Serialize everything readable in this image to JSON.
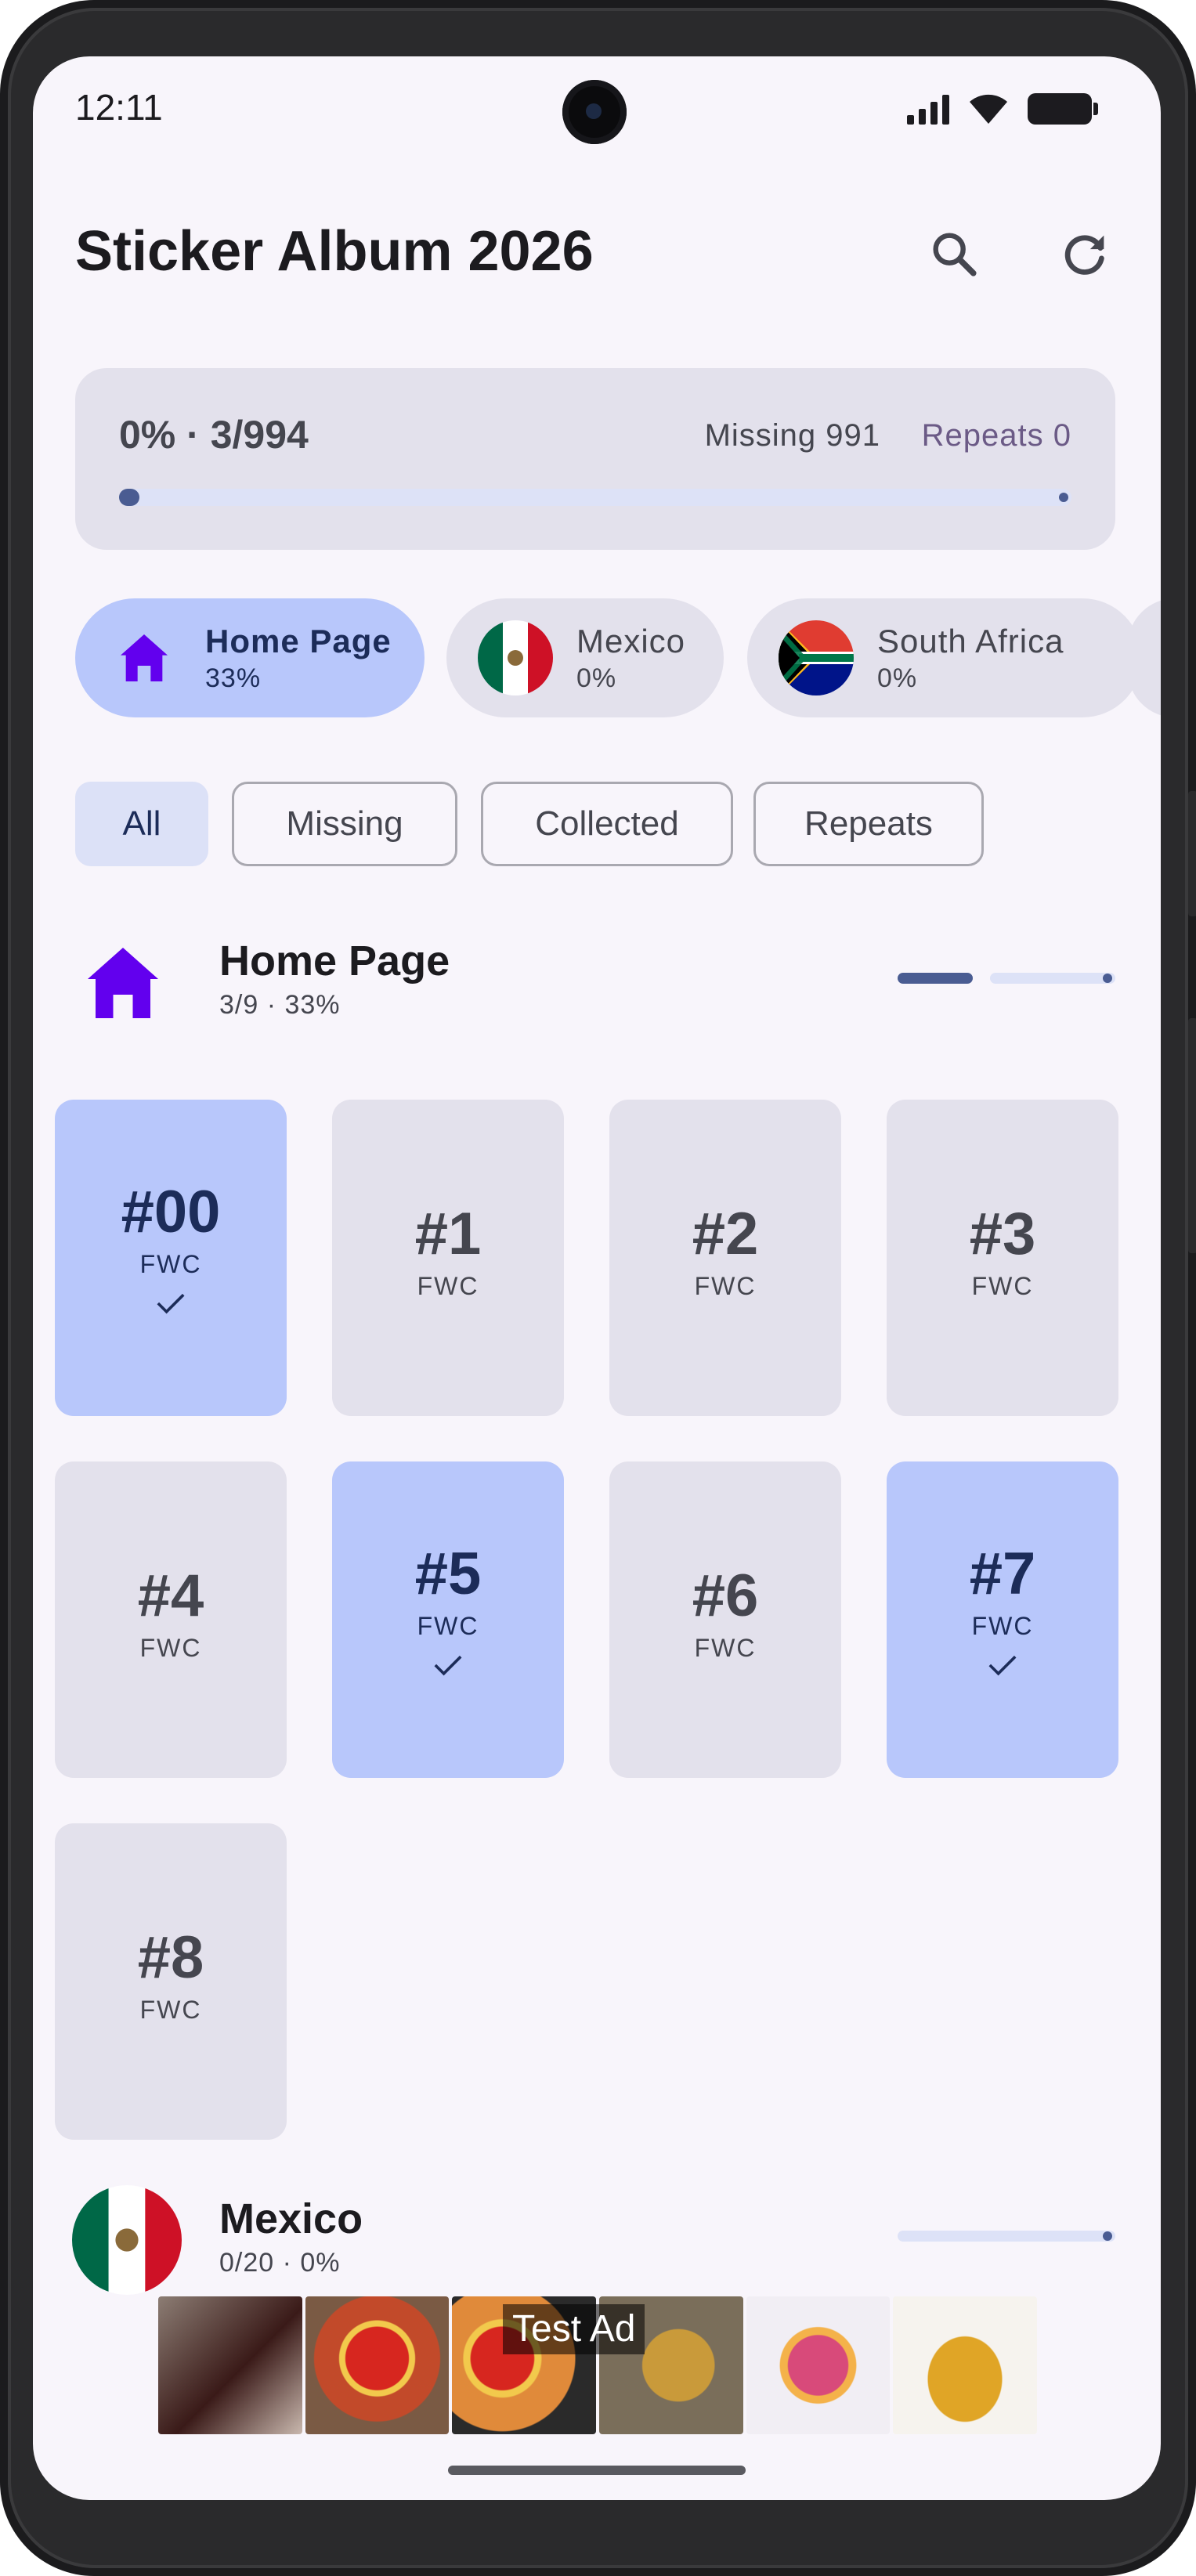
{
  "status_bar": {
    "time": "12:11"
  },
  "header": {
    "title": "Sticker Album 2026",
    "search_icon": "search-icon",
    "refresh_icon": "refresh-icon"
  },
  "progress": {
    "summary": "0% · 3/994",
    "missing": "Missing 991",
    "repeats": "Repeats 0",
    "fraction": 0.003
  },
  "categories": [
    {
      "name": "Home Page",
      "pct": "33%",
      "icon": "home-icon",
      "active": true
    },
    {
      "name": "Mexico",
      "pct": "0%",
      "icon": "mexico-flag-icon",
      "active": false
    },
    {
      "name": "South Africa",
      "pct": "0%",
      "icon": "south-africa-flag-icon",
      "active": false
    }
  ],
  "filters": [
    {
      "label": "All",
      "active": true
    },
    {
      "label": "Missing",
      "active": false
    },
    {
      "label": "Collected",
      "active": false
    },
    {
      "label": "Repeats",
      "active": false
    }
  ],
  "sections": [
    {
      "title": "Home Page",
      "subtitle": "3/9 · 33%",
      "fraction": 0.33,
      "stickers": [
        {
          "num": "#00",
          "code": "FWC",
          "owned": true
        },
        {
          "num": "#1",
          "code": "FWC",
          "owned": false
        },
        {
          "num": "#2",
          "code": "FWC",
          "owned": false
        },
        {
          "num": "#3",
          "code": "FWC",
          "owned": false
        },
        {
          "num": "#4",
          "code": "FWC",
          "owned": false
        },
        {
          "num": "#5",
          "code": "FWC",
          "owned": true
        },
        {
          "num": "#6",
          "code": "FWC",
          "owned": false
        },
        {
          "num": "#7",
          "code": "FWC",
          "owned": true
        },
        {
          "num": "#8",
          "code": "FWC",
          "owned": false
        }
      ]
    },
    {
      "title": "Mexico",
      "subtitle": "0/20 · 0%",
      "fraction": 0
    }
  ],
  "ad": {
    "label": "Test Ad"
  },
  "colors": {
    "accent": "#4a5c92",
    "chip_active": "#b8c7fb",
    "surface": "#e3e1ec",
    "background": "#f8f5fb",
    "home_icon": "#6200ee"
  }
}
